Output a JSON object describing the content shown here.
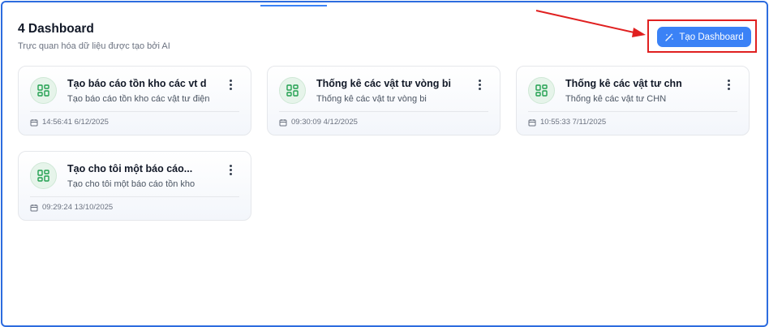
{
  "header": {
    "title": "4 Dashboard",
    "subtitle": "Trực quan hóa dữ liệu được tạo bởi AI"
  },
  "actions": {
    "create_label": "Tạo Dashboard"
  },
  "cards": [
    {
      "title": "Tạo báo cáo tồn kho các vt d",
      "description": "Tạo báo cáo tồn kho các vật tư điện",
      "timestamp": "14:56:41 6/12/2025"
    },
    {
      "title": "Thống kê các vật tư vòng bi",
      "description": "Thống kê các vật tư vòng bi",
      "timestamp": "09:30:09 4/12/2025"
    },
    {
      "title": "Thống kê các vật tư chn",
      "description": "Thống kê các vật tư CHN",
      "timestamp": "10:55:33 7/11/2025"
    },
    {
      "title": "Tạo cho tôi một báo cáo...",
      "description": "Tạo cho tôi một báo cáo tồn kho",
      "timestamp": "09:29:24 13/10/2025"
    }
  ],
  "colors": {
    "accent": "#3b82f6",
    "highlight": "#e02020",
    "icon_green": "#22a050"
  },
  "icons": {
    "create": "magic-wand-icon",
    "card": "dashboard-grid-icon",
    "menu": "more-vertical-icon",
    "time": "calendar-icon"
  }
}
